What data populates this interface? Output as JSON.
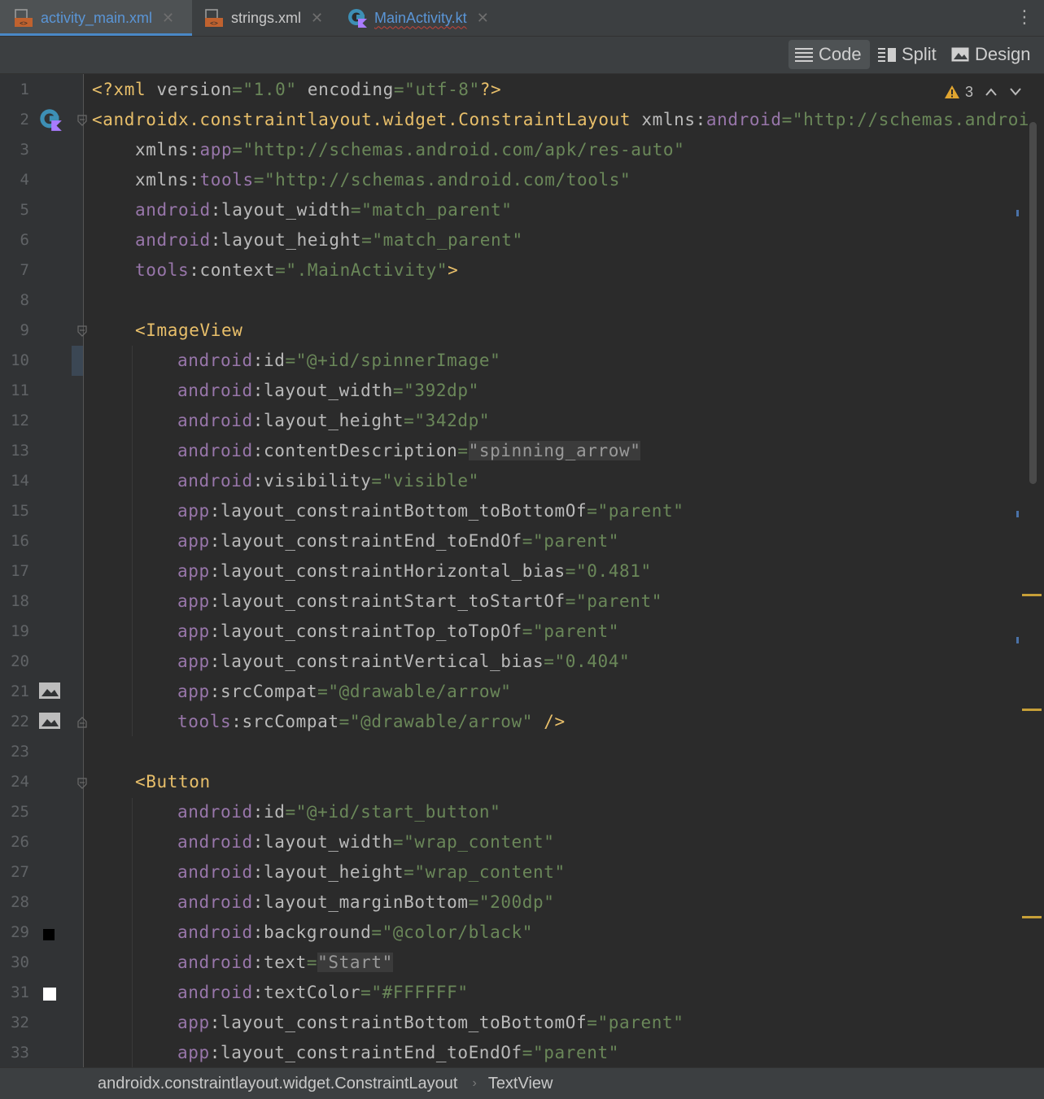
{
  "tabs": [
    {
      "label": "activity_main.xml",
      "icon": "xml-file-icon",
      "active": true
    },
    {
      "label": "strings.xml",
      "icon": "xml-file-icon",
      "active": false
    },
    {
      "label": "MainActivity.kt",
      "icon": "kotlin-class-icon",
      "active": false
    }
  ],
  "view_modes": {
    "code": "Code",
    "split": "Split",
    "design": "Design",
    "selected": "Code"
  },
  "inspection": {
    "warning_count": "3"
  },
  "line_numbers": [
    "1",
    "2",
    "3",
    "4",
    "5",
    "6",
    "7",
    "8",
    "9",
    "10",
    "11",
    "12",
    "13",
    "14",
    "15",
    "16",
    "17",
    "18",
    "19",
    "20",
    "21",
    "22",
    "23",
    "24",
    "25",
    "26",
    "27",
    "28",
    "29",
    "30",
    "31",
    "32",
    "33"
  ],
  "code": {
    "l1": {
      "open": "<?xml ",
      "a1": "version",
      "eq1": "=",
      "v1": "\"1.0\"",
      "sp": " ",
      "a2": "encoding",
      "eq2": "=",
      "v2": "\"utf-8\"",
      "close": "?>"
    },
    "l2": {
      "tag": "<androidx.constraintlayout.widget.ConstraintLayout",
      "sp": " ",
      "a": "xmlns:",
      "ns": "android",
      "eq": "=",
      "v": "\"http://schemas.android."
    },
    "l3": {
      "a": "xmlns:",
      "ns": "app",
      "eq": "=",
      "v": "\"http://schemas.android.com/apk/res-auto\""
    },
    "l4": {
      "a": "xmlns:",
      "ns": "tools",
      "eq": "=",
      "v": "\"http://schemas.android.com/tools\""
    },
    "l5": {
      "ns": "android",
      "a": ":layout_width",
      "eq": "=",
      "v": "\"match_parent\""
    },
    "l6": {
      "ns": "android",
      "a": ":layout_height",
      "eq": "=",
      "v": "\"match_parent\""
    },
    "l7": {
      "ns": "tools",
      "a": ":context",
      "eq": "=",
      "v": "\".MainActivity\"",
      "close": ">"
    },
    "l9": {
      "tag": "<ImageView"
    },
    "l10": {
      "ns": "android",
      "a": ":id",
      "eq": "=",
      "v": "\"@+id/spinnerImage\""
    },
    "l11": {
      "ns": "android",
      "a": ":layout_width",
      "eq": "=",
      "v": "\"392dp\""
    },
    "l12": {
      "ns": "android",
      "a": ":layout_height",
      "eq": "=",
      "v": "\"342dp\""
    },
    "l13": {
      "ns": "android",
      "a": ":contentDescription",
      "eq": "=",
      "v": "\"spinning_arrow\""
    },
    "l14": {
      "ns": "android",
      "a": ":visibility",
      "eq": "=",
      "v": "\"visible\""
    },
    "l15": {
      "ns": "app",
      "a": ":layout_constraintBottom_toBottomOf",
      "eq": "=",
      "v": "\"parent\""
    },
    "l16": {
      "ns": "app",
      "a": ":layout_constraintEnd_toEndOf",
      "eq": "=",
      "v": "\"parent\""
    },
    "l17": {
      "ns": "app",
      "a": ":layout_constraintHorizontal_bias",
      "eq": "=",
      "v": "\"0.481\""
    },
    "l18": {
      "ns": "app",
      "a": ":layout_constraintStart_toStartOf",
      "eq": "=",
      "v": "\"parent\""
    },
    "l19": {
      "ns": "app",
      "a": ":layout_constraintTop_toTopOf",
      "eq": "=",
      "v": "\"parent\""
    },
    "l20": {
      "ns": "app",
      "a": ":layout_constraintVertical_bias",
      "eq": "=",
      "v": "\"0.404\""
    },
    "l21": {
      "ns": "app",
      "a": ":srcCompat",
      "eq": "=",
      "v": "\"@drawable/arrow\""
    },
    "l22": {
      "ns": "tools",
      "a": ":srcCompat",
      "eq": "=",
      "v": "\"@drawable/arrow\"",
      "close": " />"
    },
    "l24": {
      "tag": "<Button"
    },
    "l25": {
      "ns": "android",
      "a": ":id",
      "eq": "=",
      "v": "\"@+id/start_button\""
    },
    "l26": {
      "ns": "android",
      "a": ":layout_width",
      "eq": "=",
      "v": "\"wrap_content\""
    },
    "l27": {
      "ns": "android",
      "a": ":layout_height",
      "eq": "=",
      "v": "\"wrap_content\""
    },
    "l28": {
      "ns": "android",
      "a": ":layout_marginBottom",
      "eq": "=",
      "v": "\"200dp\""
    },
    "l29": {
      "ns": "android",
      "a": ":background",
      "eq": "=",
      "v": "\"@color/black\""
    },
    "l30": {
      "ns": "android",
      "a": ":text",
      "eq": "=",
      "v": "\"Start\""
    },
    "l31": {
      "ns": "android",
      "a": ":textColor",
      "eq": "=",
      "v": "\"#FFFFFF\""
    },
    "l32": {
      "ns": "app",
      "a": ":layout_constraintBottom_toBottomOf",
      "eq": "=",
      "v": "\"parent\""
    },
    "l33": {
      "ns": "app",
      "a": ":layout_constraintEnd_toEndOf",
      "eq": "=",
      "v": "\"parent\""
    }
  },
  "gutter_swatches": {
    "black": "#000000",
    "white": "#FFFFFF"
  },
  "breadcrumb": {
    "item1": "androidx.constraintlayout.widget.ConstraintLayout",
    "item2": "TextView"
  },
  "colors": {
    "accent": "#4a88c7",
    "warning": "#c69f38",
    "tag": "#e8bf6a",
    "namespace": "#9876aa",
    "string": "#6a8759"
  }
}
